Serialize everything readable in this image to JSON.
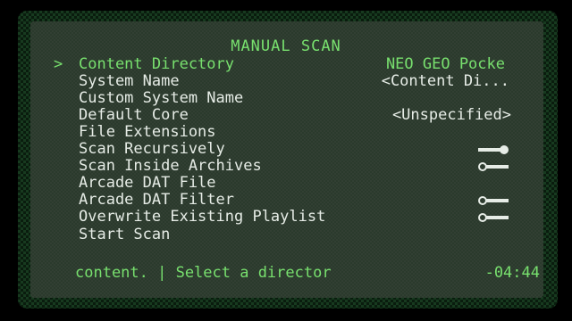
{
  "menu": {
    "title": "MANUAL SCAN",
    "cursor_glyph": ">",
    "items": [
      {
        "label": "Content Directory",
        "value": "NEO GEO Pocke",
        "selected": true
      },
      {
        "label": "System Name",
        "value": "<Content Di..."
      },
      {
        "label": "Custom System Name",
        "value": ""
      },
      {
        "label": "Default Core",
        "value": "<Unspecified>"
      },
      {
        "label": "File Extensions",
        "value": ""
      },
      {
        "label": "Scan Recursively",
        "toggle": "on"
      },
      {
        "label": "Scan Inside Archives",
        "toggle": "off"
      },
      {
        "label": "Arcade DAT File",
        "value": ""
      },
      {
        "label": "Arcade DAT Filter",
        "toggle": "off"
      },
      {
        "label": "Overwrite Existing Playlist",
        "toggle": "off"
      },
      {
        "label": "Start Scan",
        "value": ""
      }
    ]
  },
  "footer": {
    "sublabel": "content. | Select a director",
    "clock": "-04:44"
  },
  "colors": {
    "accent": "#78e06e",
    "text": "#e6ece6",
    "panel": "#2a3a2c",
    "border": "#173a1f"
  }
}
